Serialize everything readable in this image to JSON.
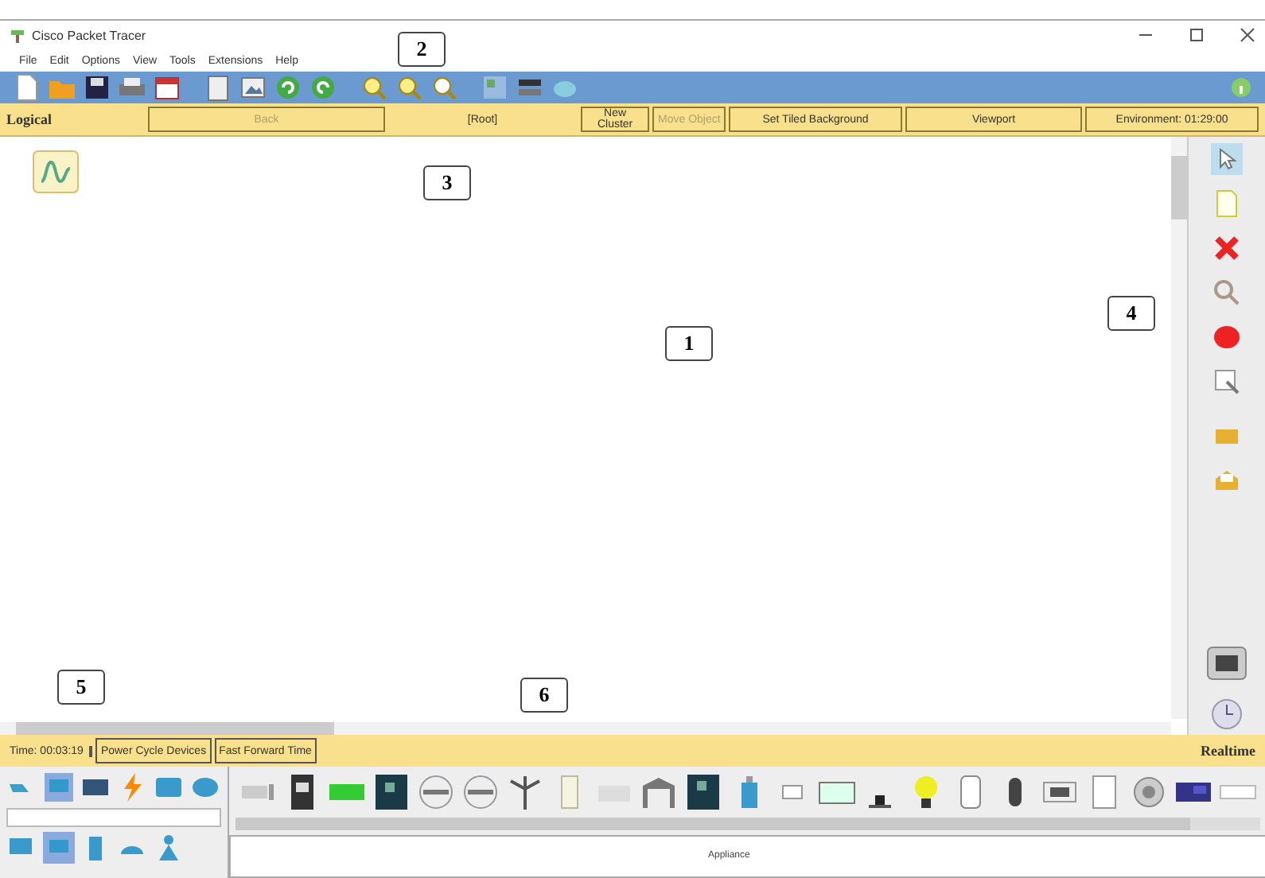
{
  "window": {
    "title": "Cisco Packet Tracer"
  },
  "menu": [
    "File",
    "Edit",
    "Options",
    "View",
    "Tools",
    "Extensions",
    "Help"
  ],
  "workspace_bar": {
    "mode": "Logical",
    "buttons": [
      {
        "label": "Back",
        "disabled": true
      },
      {
        "label": "[Root]",
        "disabled": false
      },
      {
        "label": "New Cluster",
        "disabled": false
      },
      {
        "label": "Move Object",
        "disabled": true
      },
      {
        "label": "Set Tiled Background",
        "disabled": false
      },
      {
        "label": "Viewport",
        "disabled": false
      },
      {
        "label": "Environment: 01:29:00",
        "disabled": false
      }
    ]
  },
  "time_bar": {
    "time": "Time: 00:03:19",
    "buttons": [
      "Power Cycle Devices",
      "Fast Forward Time"
    ],
    "mode": "Realtime"
  },
  "device_panel": {
    "caption": "Appliance"
  },
  "callouts": [
    "1",
    "2",
    "3",
    "4",
    "5",
    "6"
  ]
}
